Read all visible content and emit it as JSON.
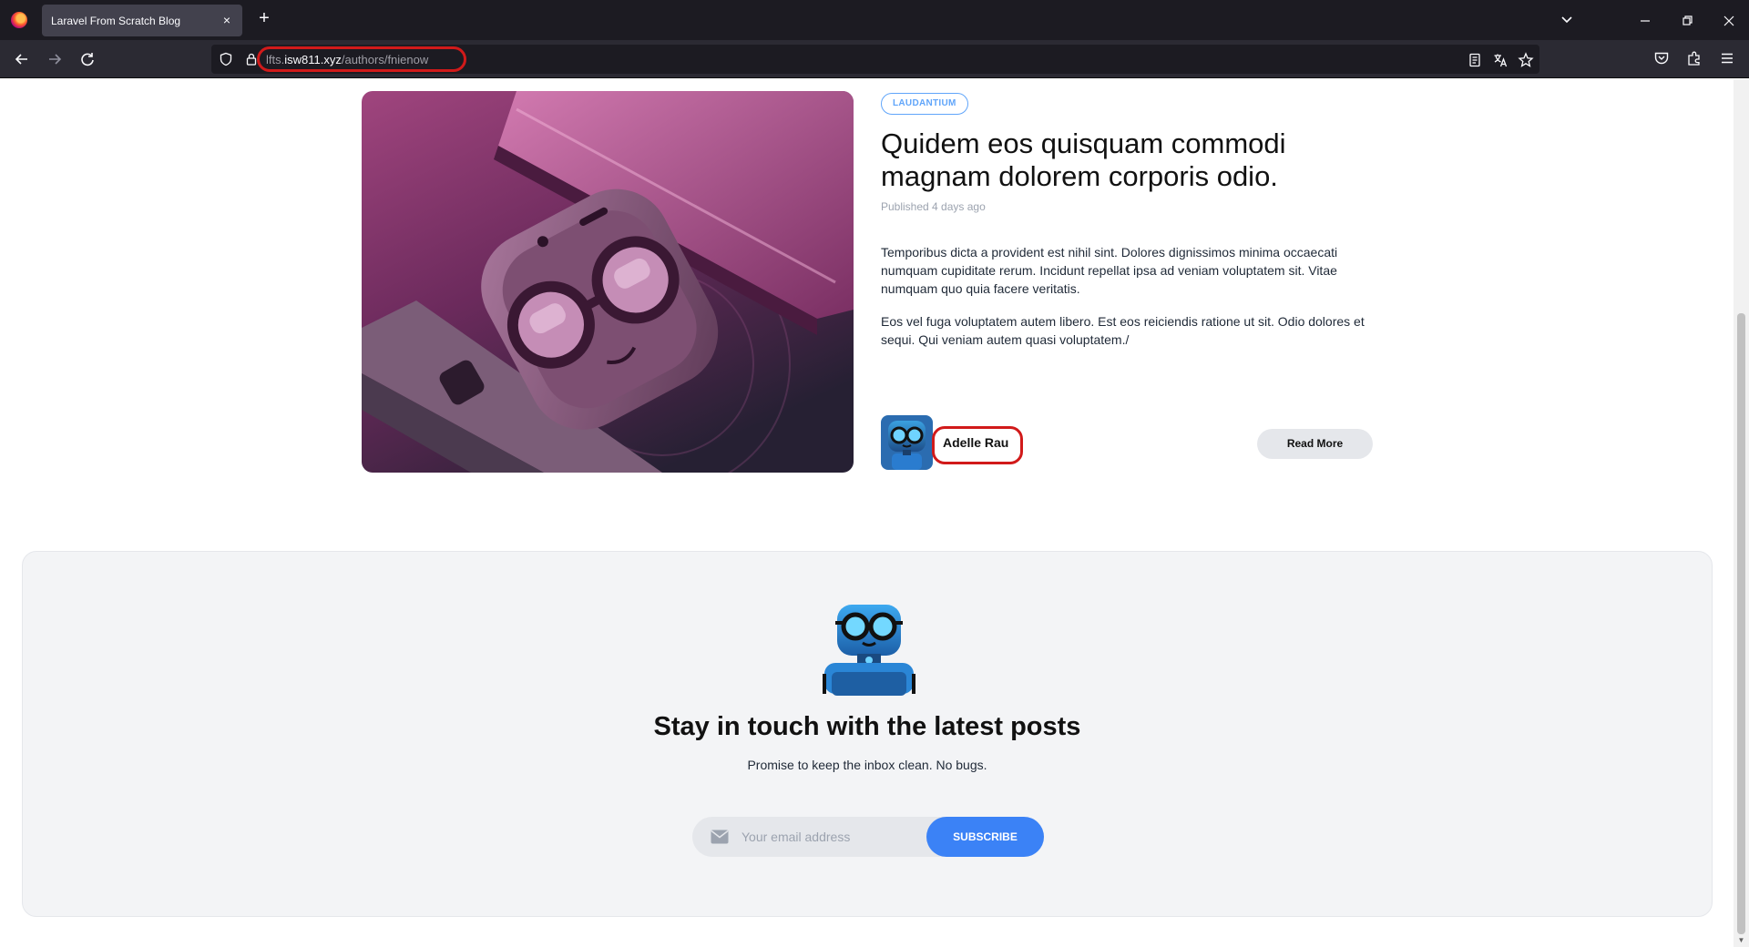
{
  "browser": {
    "tab_title": "Laravel From Scratch Blog",
    "tab_close": "×",
    "new_tab": "+",
    "url_domain_prefix": "lfts.",
    "url_domain": "isw811.xyz",
    "url_path": "/authors/fnienow"
  },
  "post": {
    "category": "LAUDANTIUM",
    "title": "Quidem eos quisquam commodi magnam dolorem corporis odio.",
    "published_prefix": "Published ",
    "published_ago": "4 days ago",
    "excerpt_p1": "Temporibus dicta a provident est nihil sint. Dolores dignissimos minima occaecati numquam cupiditate rerum. Incidunt repellat ipsa ad veniam voluptatem sit. Vitae numquam quo quia facere veritatis.",
    "excerpt_p2": "Eos vel fuga voluptatem autem libero. Est eos reiciendis ratione ut sit. Odio dolores et sequi. Qui veniam autem quasi voluptatem./",
    "author_name": "Adelle Rau",
    "read_more": "Read More"
  },
  "newsletter": {
    "heading": "Stay in touch with the latest posts",
    "subheading": "Promise to keep the inbox clean. No bugs.",
    "email_placeholder": "Your email address",
    "subscribe": "SUBSCRIBE"
  },
  "colors": {
    "accent_blue": "#3b82f6",
    "pill_blue": "#60a5fa",
    "annotation_red": "#d11a1a"
  }
}
